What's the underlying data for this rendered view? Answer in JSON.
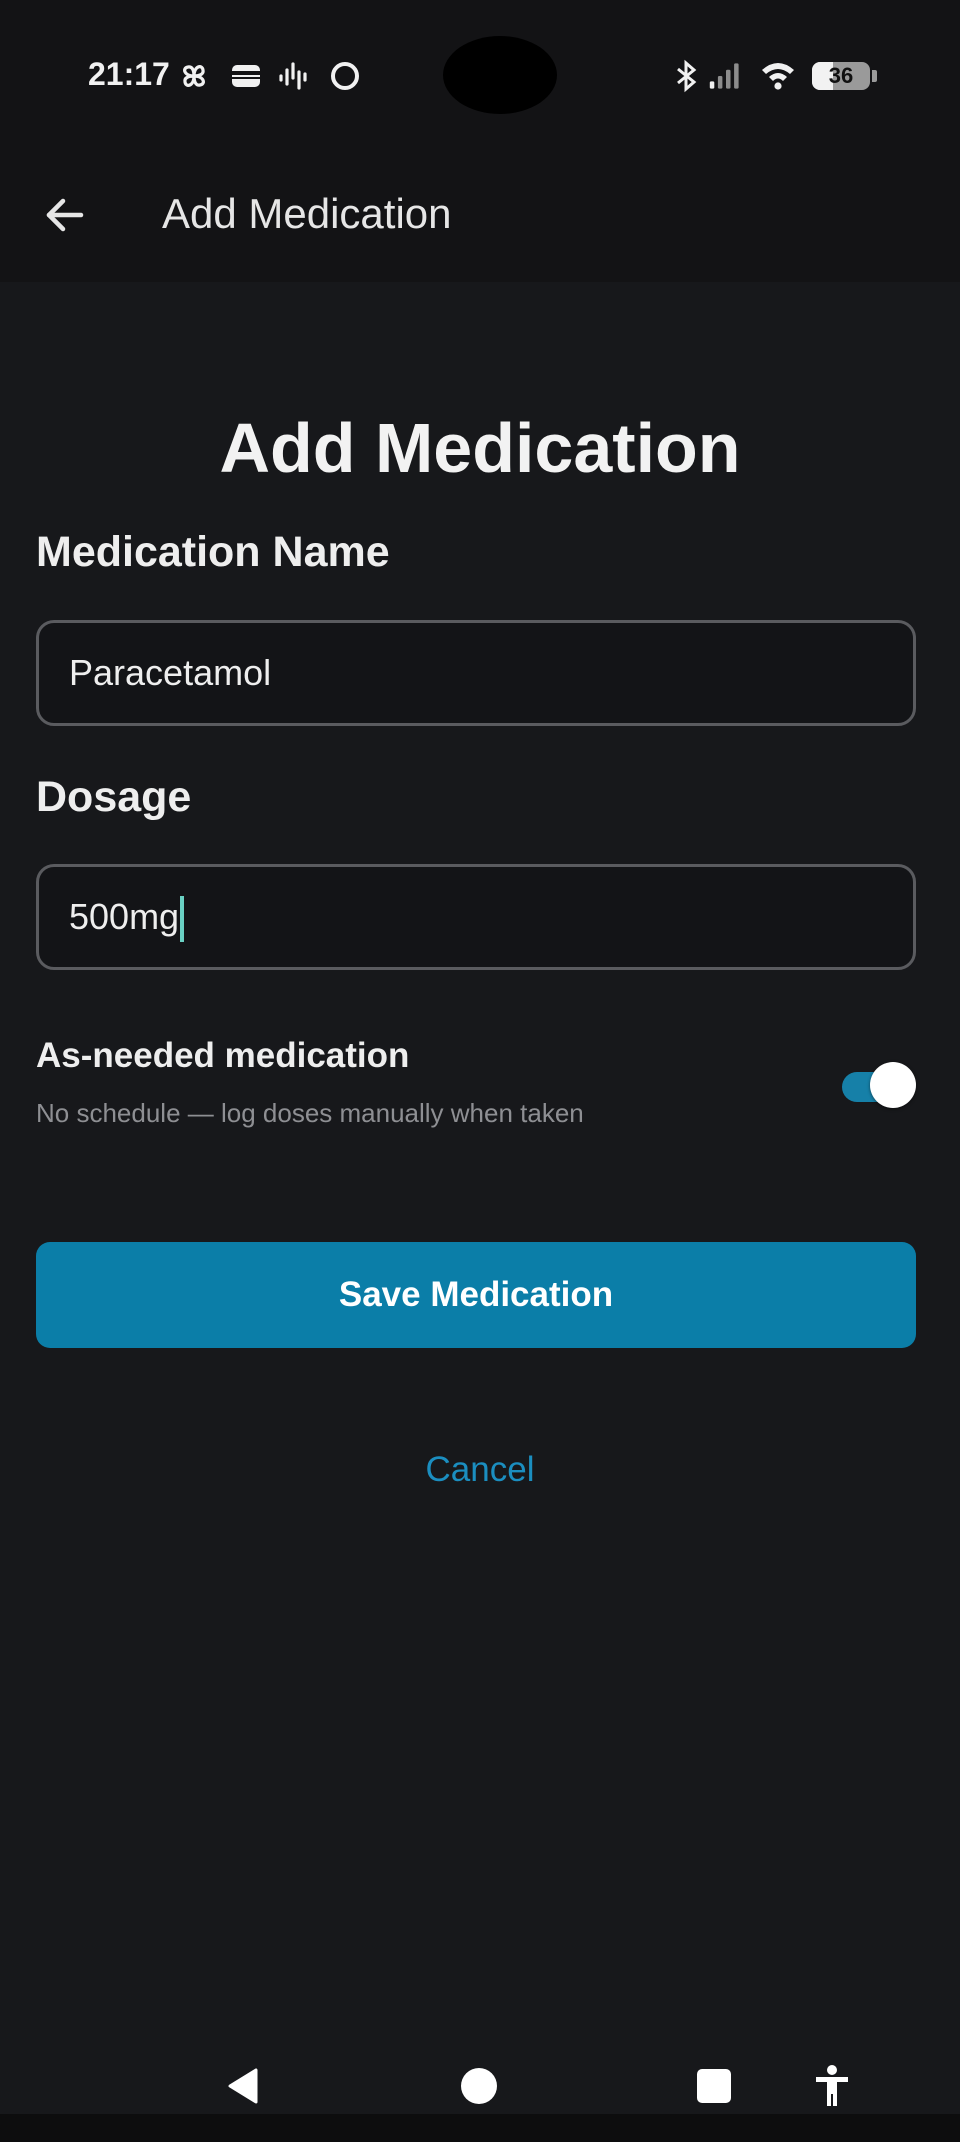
{
  "status_bar": {
    "time": "21:17",
    "battery_level": "36",
    "battery_fraction": 0.36,
    "left_icons": [
      "pinwheel-icon",
      "wallet-icon",
      "waveform-icon",
      "circle-icon"
    ],
    "right_icons": [
      "bluetooth-icon",
      "signal-icon",
      "wifi-icon",
      "battery-icon"
    ]
  },
  "app_bar": {
    "title": "Add Medication",
    "back_icon": "arrow-left-icon"
  },
  "form": {
    "heading": "Add Medication",
    "name_label": "Medication Name",
    "name_value": "Paracetamol",
    "dosage_label": "Dosage",
    "dosage_value": "500mg",
    "as_needed": {
      "title": "As-needed medication",
      "subtitle": "No schedule — log doses manually when taken",
      "enabled": true
    },
    "save_label": "Save Medication",
    "cancel_label": "Cancel"
  },
  "colors": {
    "background": "#17181b",
    "accent": "#0b7ea8",
    "link": "#1b8ec0",
    "cursor": "#6ad1c4"
  },
  "nav_bar": {
    "icons": [
      "back-triangle-icon",
      "home-circle-icon",
      "recents-square-icon",
      "accessibility-icon"
    ]
  }
}
